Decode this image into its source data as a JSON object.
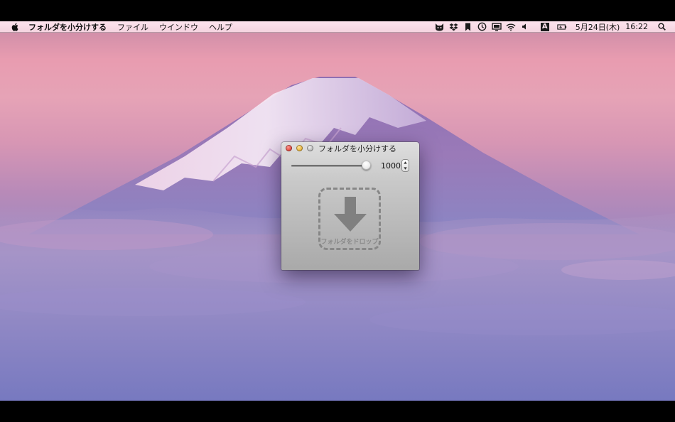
{
  "menubar": {
    "apple_icon": "apple-icon",
    "app_menu": "フォルダを小分けする",
    "items": [
      "ファイル",
      "ウインドウ",
      "ヘルプ"
    ],
    "tray_icons": [
      "cat-icon",
      "dropbox-icon",
      "bookmark-icon",
      "time-machine-icon",
      "display-icon",
      "wifi-icon",
      "volume-icon",
      "input-method-icon",
      "battery-icon"
    ],
    "input_method_label": "A",
    "date": "5月24日(木)",
    "time": "16:22",
    "search_icon": "spotlight-search-icon"
  },
  "window": {
    "title": "フォルダを小分けする",
    "slider": {
      "level": 1.0
    },
    "count_value": "1000",
    "drop_zone": {
      "label": "フォルダをドロップ",
      "icon": "down-arrow-icon"
    }
  },
  "desktop": {
    "wallpaper": "mount-fuji-sunset",
    "accent_colors": {
      "sky_pink": "#e89cb0",
      "clouds_violet": "#8d87c6",
      "snow": "#efe6f5"
    }
  }
}
